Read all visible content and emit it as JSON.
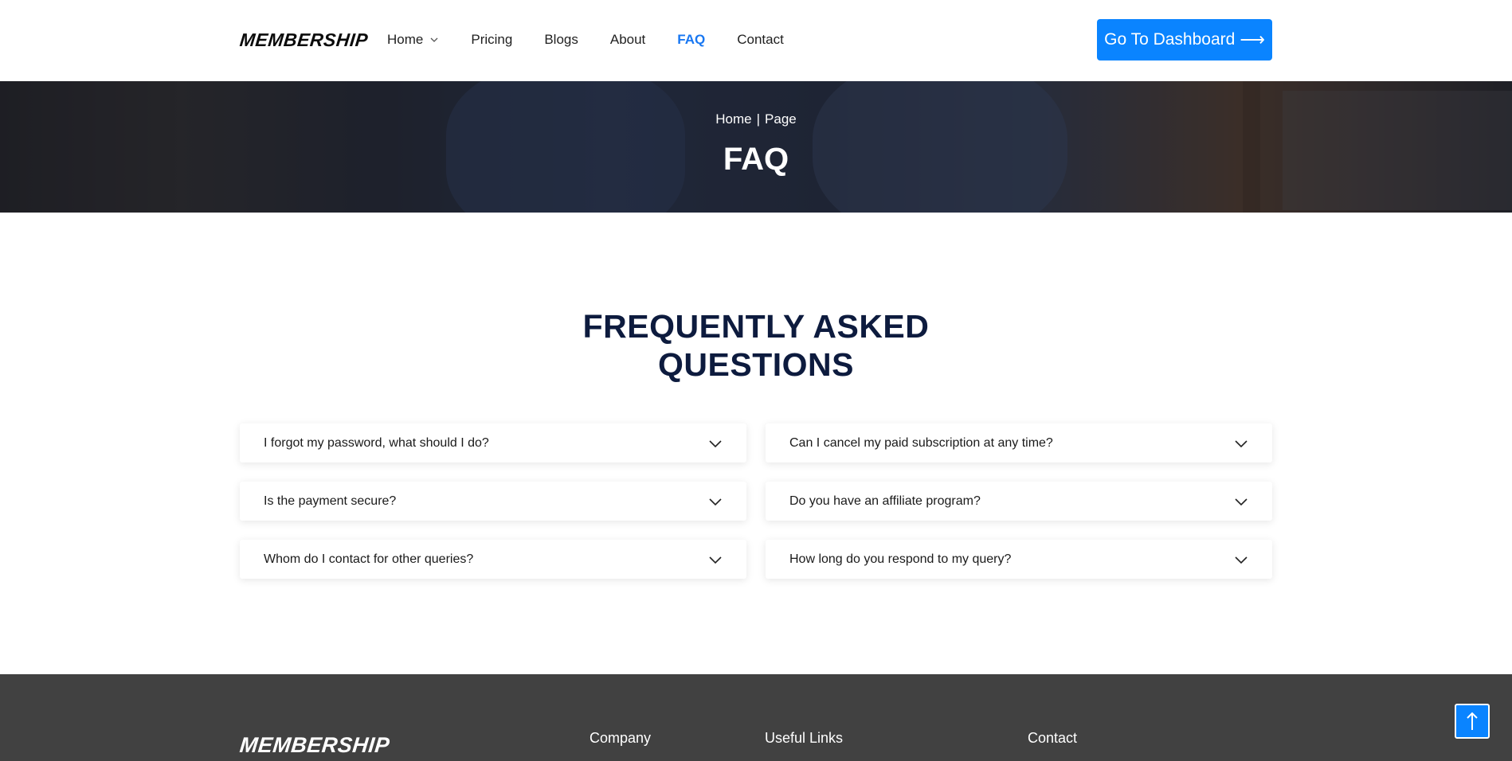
{
  "brand": {
    "logo": "MEMBERSHIP"
  },
  "nav": {
    "items": [
      {
        "label": "Home",
        "has_dropdown": true,
        "active": false
      },
      {
        "label": "Pricing",
        "active": false
      },
      {
        "label": "Blogs",
        "active": false
      },
      {
        "label": "About",
        "active": false
      },
      {
        "label": "FAQ",
        "active": true
      },
      {
        "label": "Contact",
        "active": false
      }
    ],
    "cta_label": "Go To Dashboard",
    "cta_arrow": "⟶"
  },
  "hero": {
    "breadcrumb": {
      "home": "Home",
      "separator": "|",
      "current": "Page"
    },
    "title": "FAQ"
  },
  "faq": {
    "title_line1": "FREQUENTLY ASKED",
    "title_line2": "QUESTIONS",
    "items": [
      {
        "question": "I forgot my password, what should I do?"
      },
      {
        "question": "Can I cancel my paid subscription at any time?"
      },
      {
        "question": "Is the payment secure?"
      },
      {
        "question": "Do you have an affiliate program?"
      },
      {
        "question": "Whom do I contact for other queries?"
      },
      {
        "question": "How long do you respond to my query?"
      }
    ]
  },
  "footer": {
    "logo": "MEMBERSHIP",
    "columns": [
      "Company",
      "Useful Links",
      "Contact"
    ]
  },
  "colors": {
    "accent": "#0a84ff",
    "active_nav": "#1877f2",
    "heading": "#0d1b3e",
    "footer_bg": "#414141"
  },
  "icons": {
    "dropdown": "chevron-down-icon",
    "scroll_top": "arrow-up-icon"
  }
}
